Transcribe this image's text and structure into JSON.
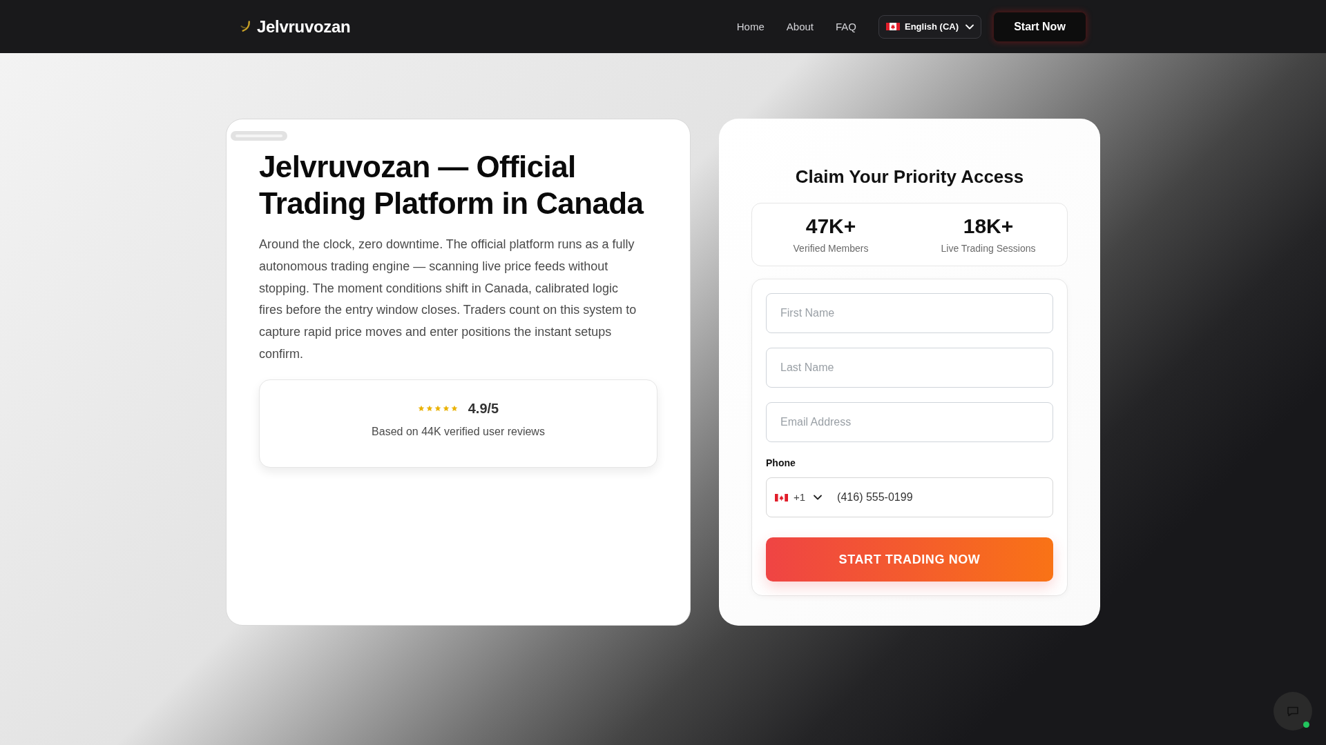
{
  "header": {
    "logo": "Jelvruvozan",
    "nav": [
      "Home",
      "About",
      "FAQ"
    ],
    "language": "English (CA)",
    "cta": "Start Now"
  },
  "hero": {
    "title": "Jelvruvozan — Official Trading Platform in Canada",
    "description": "Around the clock, zero downtime. The official platform runs as a fully autonomous trading engine — scanning live price feeds without stopping. The moment conditions shift in Canada, calibrated logic fires before the entry window closes. Traders count on this system to capture rapid price moves and enter positions the instant setups confirm.",
    "rating": {
      "stars": 5,
      "score": "4.9/5",
      "caption": "Based on 44K verified user reviews"
    }
  },
  "form": {
    "title": "Claim Your Priority Access",
    "stats": [
      {
        "value": "47K+",
        "label": "Verified Members"
      },
      {
        "value": "18K+",
        "label": "Live Trading Sessions"
      }
    ],
    "fields": [
      {
        "placeholder": "First Name"
      },
      {
        "placeholder": "Last Name"
      },
      {
        "placeholder": "Email Address"
      }
    ],
    "phone": {
      "label": "Phone",
      "code": "+1",
      "value": "(416) 555-0199"
    },
    "submit": "START TRADING NOW"
  },
  "chat": {
    "online": true
  }
}
